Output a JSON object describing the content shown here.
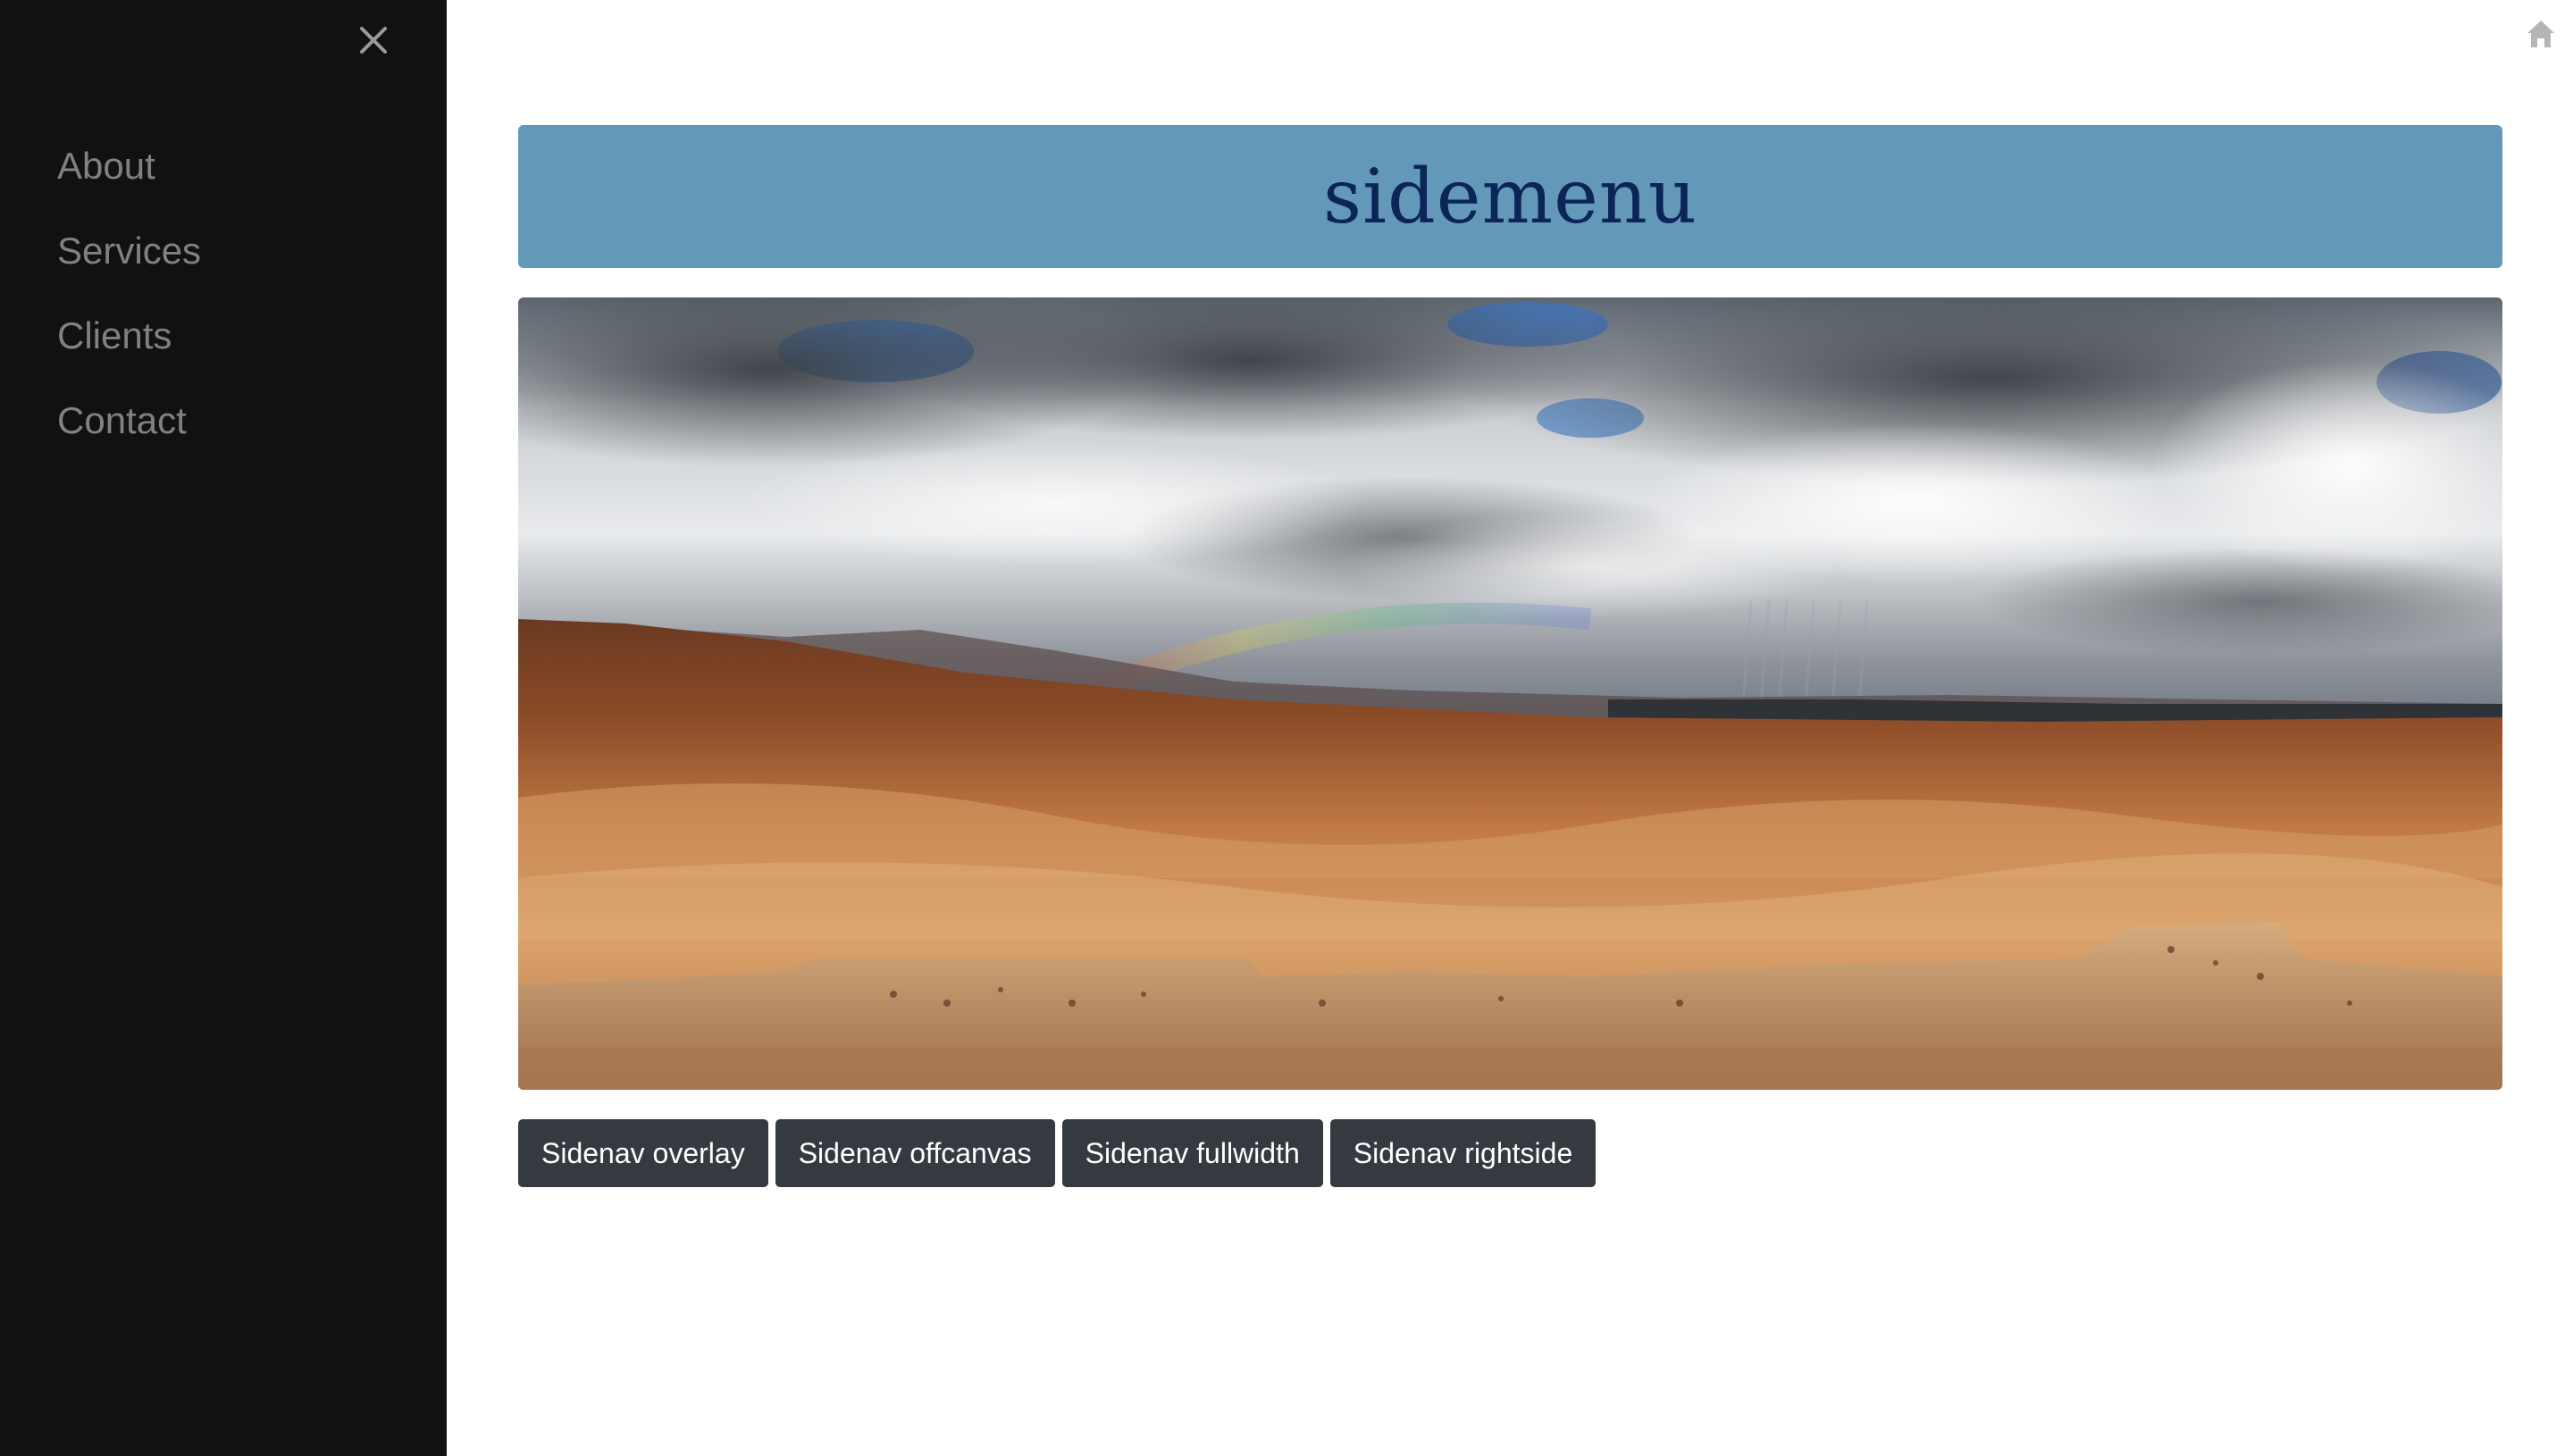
{
  "sidenav": {
    "close_icon": "close-icon",
    "items": [
      {
        "label": "About"
      },
      {
        "label": "Services"
      },
      {
        "label": "Clients"
      },
      {
        "label": "Contact"
      }
    ]
  },
  "topbar": {
    "home_icon": "home-icon"
  },
  "header": {
    "title": "sidemenu"
  },
  "hero": {
    "image": "desert-landscape-with-storm-clouds-and-rainbow"
  },
  "buttons": [
    {
      "label": "Sidenav overlay"
    },
    {
      "label": "Sidenav offcanvas"
    },
    {
      "label": "Sidenav fullwidth"
    },
    {
      "label": "Sidenav rightside"
    }
  ],
  "colors": {
    "sidenav_bg": "#111111",
    "nav_text": "#818181",
    "banner_bg": "#6398b8",
    "title_text": "#0b2557",
    "button_bg": "#343a40"
  }
}
